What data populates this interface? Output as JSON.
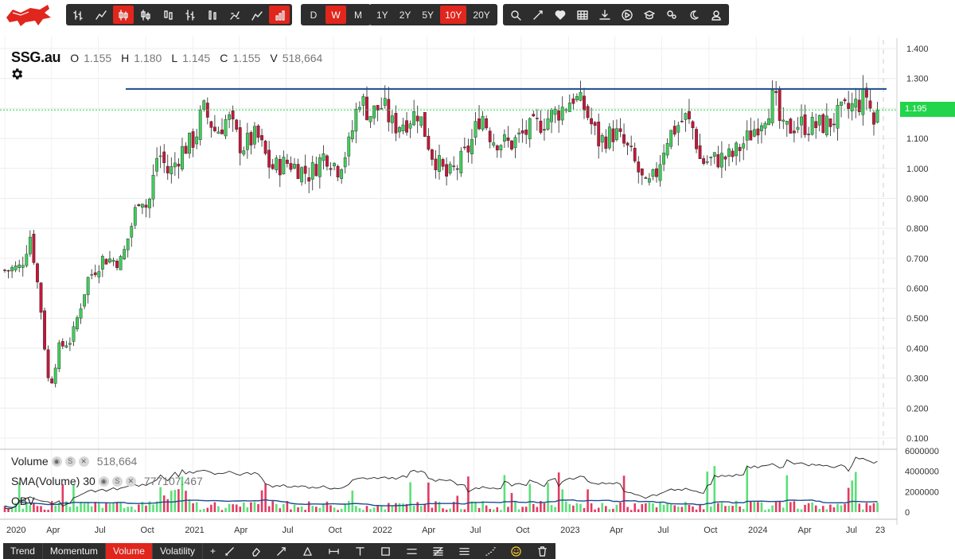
{
  "toolbar": {
    "chart_type_buttons": [
      {
        "icon": "ohlc-icon",
        "active": false
      },
      {
        "icon": "line-icon",
        "active": false
      },
      {
        "icon": "candlestick-icon",
        "active": true
      },
      {
        "icon": "hollow-candle-icon",
        "active": false
      },
      {
        "icon": "candle-volume-icon",
        "active": false
      },
      {
        "icon": "hlc-icon",
        "active": false
      },
      {
        "icon": "colored-bars-icon",
        "active": false
      },
      {
        "icon": "kagi-icon",
        "active": false
      },
      {
        "icon": "mountain-icon",
        "active": false
      },
      {
        "icon": "volume-candle-icon",
        "active": true
      }
    ],
    "periods": [
      {
        "label": "D",
        "active": false
      },
      {
        "label": "W",
        "active": true
      },
      {
        "label": "M",
        "active": false
      }
    ],
    "ranges": [
      {
        "label": "1Y",
        "active": false
      },
      {
        "label": "2Y",
        "active": false
      },
      {
        "label": "5Y",
        "active": false
      },
      {
        "label": "10Y",
        "active": true
      },
      {
        "label": "20Y",
        "active": false
      }
    ],
    "tools": [
      "search-icon",
      "compare-icon",
      "heart-icon",
      "table-icon",
      "download-icon",
      "play-icon",
      "education-icon",
      "settings-icon",
      "dark-mode-icon",
      "user-icon"
    ]
  },
  "ohlc": {
    "ticker": "SSG.au",
    "o_label": "O",
    "o": "1.155",
    "h_label": "H",
    "h": "1.180",
    "l_label": "L",
    "l": "1.145",
    "c_label": "C",
    "c": "1.155",
    "v_label": "V",
    "v": "518,664"
  },
  "price_flag": "1.195",
  "indicators": {
    "volume": {
      "label": "Volume",
      "value": "518,664"
    },
    "sma": {
      "label": "SMA(Volume) 30",
      "value": "777107.467"
    },
    "obv": {
      "label": "OBV"
    }
  },
  "bottom_tabs": [
    {
      "label": "Trend",
      "active": false
    },
    {
      "label": "Momentum",
      "active": false
    },
    {
      "label": "Volume",
      "active": true
    },
    {
      "label": "Volatility",
      "active": false
    },
    {
      "label": "+",
      "active": false
    }
  ],
  "draw_tools": [
    "trendline-icon",
    "eraser-icon",
    "arrow-icon",
    "triangle-icon",
    "measure-icon",
    "text-icon",
    "rectangle-icon",
    "horizontal-line-icon",
    "fibonacci-icon",
    "channel-icon",
    "dotted-line-icon",
    "emoji-icon",
    "trash-icon"
  ],
  "colors": {
    "up": "#3fce5a",
    "down": "#c4173a",
    "accent": "#e0261d",
    "resistance": "#1c4c8e",
    "current_price": "#22d54a"
  },
  "chart_data": {
    "type": "candlestick",
    "title": "SSG.au",
    "interval": "weekly",
    "price_axis": {
      "ticks": [
        0.1,
        0.2,
        0.3,
        0.4,
        0.5,
        0.6,
        0.7,
        0.8,
        0.9,
        1.0,
        1.1,
        1.2,
        1.3,
        1.4
      ],
      "labels": [
        "0.100",
        "0.200",
        "0.300",
        "0.400",
        "0.500",
        "0.600",
        "0.700",
        "0.800",
        "0.900",
        "1.000",
        "1.100",
        "1.200",
        "1.300",
        "1.400"
      ],
      "range": [
        0.07,
        1.45
      ]
    },
    "volume_axis": {
      "ticks": [
        0,
        2000000,
        4000000,
        6000000
      ],
      "labels": [
        "0",
        "2000000",
        "4000000",
        "6000000"
      ]
    },
    "time_axis": {
      "labels": [
        "2020",
        "Apr",
        "Jul",
        "Oct",
        "2021",
        "Apr",
        "Jul",
        "Oct",
        "2022",
        "Apr",
        "Jul",
        "Oct",
        "2023",
        "Apr",
        "Jul",
        "Oct",
        "2024",
        "Apr",
        "Jul",
        "23"
      ],
      "range": [
        "2020-01",
        "2024-09"
      ]
    },
    "resistance_level": 1.265,
    "current_price": 1.195,
    "grid": true,
    "close_path": [
      [
        "2020-01",
        0.66
      ],
      [
        "2020-02",
        0.67
      ],
      [
        "2020-02-20",
        0.78
      ],
      [
        "2020-03-10",
        0.55
      ],
      [
        "2020-03-20",
        0.38
      ],
      [
        "2020-03-28",
        0.26
      ],
      [
        "2020-04-15",
        0.4
      ],
      [
        "2020-05-10",
        0.43
      ],
      [
        "2020-06-10",
        0.63
      ],
      [
        "2020-07-10",
        0.7
      ],
      [
        "2020-08-15",
        0.69
      ],
      [
        "2020-09-05",
        0.82
      ],
      [
        "2020-09-20",
        0.92
      ],
      [
        "2020-10-05",
        0.86
      ],
      [
        "2020-10-25",
        1.06
      ],
      [
        "2020-11-15",
        0.98
      ],
      [
        "2020-12-10",
        1.06
      ],
      [
        "2021-01-05",
        1.1
      ],
      [
        "2021-01-20",
        1.2
      ],
      [
        "2021-02-15",
        1.12
      ],
      [
        "2021-03-10",
        1.17
      ],
      [
        "2021-04-05",
        1.07
      ],
      [
        "2021-05-05",
        1.11
      ],
      [
        "2021-06-01",
        1.0
      ],
      [
        "2021-07-05",
        1.02
      ],
      [
        "2021-08-15",
        0.98
      ],
      [
        "2021-09-15",
        1.05
      ],
      [
        "2021-10-10",
        1.0
      ],
      [
        "2021-11-01",
        1.08
      ],
      [
        "2021-11-20",
        1.24
      ],
      [
        "2021-12-10",
        1.18
      ],
      [
        "2022-01-05",
        1.21
      ],
      [
        "2022-01-25",
        1.14
      ],
      [
        "2022-02-20",
        1.16
      ],
      [
        "2022-03-15",
        1.19
      ],
      [
        "2022-04-10",
        1.05
      ],
      [
        "2022-05-10",
        0.97
      ],
      [
        "2022-06-01",
        1.01
      ],
      [
        "2022-06-25",
        1.08
      ],
      [
        "2022-07-15",
        1.19
      ],
      [
        "2022-08-05",
        1.1
      ],
      [
        "2022-09-10",
        1.08
      ],
      [
        "2022-10-10",
        1.12
      ],
      [
        "2022-11-15",
        1.16
      ],
      [
        "2022-12-20",
        1.2
      ],
      [
        "2023-01-10",
        1.24
      ],
      [
        "2023-02-01",
        1.2
      ],
      [
        "2023-03-01",
        1.09
      ],
      [
        "2023-04-01",
        1.12
      ],
      [
        "2023-05-01",
        1.05
      ],
      [
        "2023-06-01",
        0.93
      ],
      [
        "2023-06-20",
        0.98
      ],
      [
        "2023-07-10",
        1.1
      ],
      [
        "2023-08-15",
        1.17
      ],
      [
        "2023-09-01",
        1.13
      ],
      [
        "2023-09-15",
        1.02
      ],
      [
        "2023-10-15",
        1.03
      ],
      [
        "2023-11-15",
        1.04
      ],
      [
        "2023-12-15",
        1.1
      ],
      [
        "2024-01-20",
        1.19
      ],
      [
        "2024-02-05",
        1.24
      ],
      [
        "2024-02-20",
        1.12
      ],
      [
        "2024-03-20",
        1.15
      ],
      [
        "2024-04-20",
        1.14
      ],
      [
        "2024-05-20",
        1.15
      ],
      [
        "2024-06-20",
        1.19
      ],
      [
        "2024-07-20",
        1.22
      ],
      [
        "2024-08-05",
        1.25
      ],
      [
        "2024-08-15",
        1.14
      ],
      [
        "2024-08-25",
        1.195
      ]
    ],
    "series": [
      {
        "name": "Volume",
        "last": 518664
      },
      {
        "name": "SMA(Volume) 30",
        "last": 777107.467
      },
      {
        "name": "OBV"
      }
    ]
  }
}
